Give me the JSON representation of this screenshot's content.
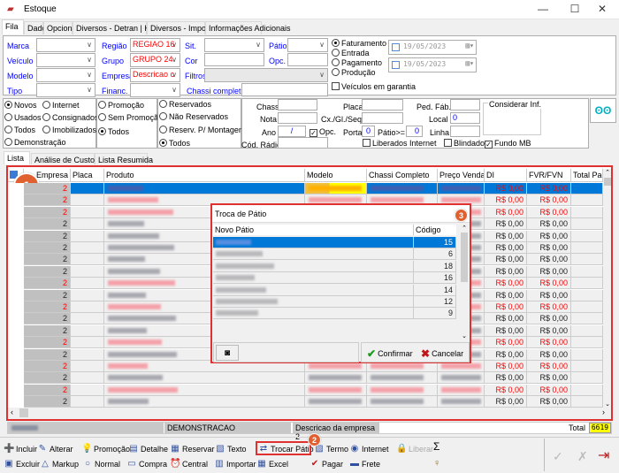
{
  "window": {
    "title": "Estoque",
    "minimize": "—",
    "maximize": "☐",
    "close": "✕"
  },
  "tabs": [
    "Fila",
    "Dados",
    "Opcionais",
    "Diversos - Detran | Hold Back",
    "Diversos - Importados",
    "Informações Adicionais"
  ],
  "filters": {
    "marca": "Marca",
    "veiculo": "Veículo",
    "modelo": "Modelo",
    "tipo": "Tipo",
    "regiao": "Região",
    "regiao_value": "REGIAO 16",
    "grupo": "Grupo",
    "grupo_value": "GRUPO 24",
    "empresa": "Empresa",
    "empresa_value": "Descricao c",
    "financ": "Financ.",
    "sit": "Sit.",
    "cor": "Cor",
    "filtros": "Filtros",
    "chassi_completo": "Chassi completo",
    "patio": "Pátio",
    "opc": "Opc.",
    "date_radios": [
      "Faturamento",
      "Entrada",
      "Pagamento",
      "Produção"
    ],
    "date_selected": "Faturamento",
    "date1": "19/05/2023",
    "date2": "19/05/2023",
    "garantia": "Veículos em garantia"
  },
  "options": {
    "group1": [
      "Novos",
      "Internet",
      "Usados",
      "Consignados",
      "Todos",
      "Imobilizados",
      "Demonstração"
    ],
    "group1_selected": "Novos",
    "group2": [
      "Promoção",
      "Sem Promoção",
      "Todos"
    ],
    "group2_selected": "Todos",
    "group3": [
      "Reservados",
      "Não Reservados",
      "Reserv. P/ Montagem",
      "Todos"
    ],
    "group3_selected": "Todos",
    "chassi": "Chassi",
    "nota": "Nota",
    "ano": "Ano",
    "ano_value": "/",
    "opc": "Opc.",
    "cod_radio": "Cód. Rádio",
    "placa": "Placa",
    "cx": "Cx./Gl./Seq.",
    "porta": "Porta",
    "porta_value": "0",
    "patio_ge": "Pátio>=",
    "patio_value": "0",
    "ped_fab": "Ped. Fáb.",
    "local": "Local",
    "local_value": "0",
    "linha": "Linha",
    "considerar": "Considerar Inf.",
    "liberados": "Liberados Internet",
    "blindado": "Blindado",
    "fundo_mb": "Fundo MB"
  },
  "subtabs": [
    "Lista",
    "Análise de Custos",
    "Lista Resumida"
  ],
  "grid": {
    "columns": [
      "Empresa",
      "Placa",
      "Produto",
      "Modelo",
      "Chassi Completo",
      "Preço Venda",
      "DI",
      "FVR/FVN",
      "Total Pag"
    ],
    "rows": [
      {
        "empresa": "2",
        "di": "R$ 0,00",
        "fvr": "R$ 0,00",
        "highlight": true,
        "selected": true
      },
      {
        "empresa": "2",
        "di": "R$ 0,00",
        "fvr": "R$ 0,00",
        "highlight": true
      },
      {
        "empresa": "2",
        "di": "R$ 0,00",
        "fvr": "R$ 0,00",
        "highlight": true
      },
      {
        "empresa": "2",
        "di": "R$ 0,00",
        "fvr": "R$ 0,00",
        "highlight": false
      },
      {
        "empresa": "2",
        "di": "R$ 0,00",
        "fvr": "R$ 0,00",
        "highlight": false
      },
      {
        "empresa": "2",
        "di": "R$ 0,00",
        "fvr": "R$ 0,00",
        "highlight": false
      },
      {
        "empresa": "2",
        "di": "R$ 0,00",
        "fvr": "R$ 0,00",
        "highlight": false
      },
      {
        "empresa": "2",
        "di": "R$ 0,00",
        "fvr": "R$ 0,00",
        "highlight": false
      },
      {
        "empresa": "2",
        "di": "R$ 0,00",
        "fvr": "R$ 0,00",
        "highlight": true
      },
      {
        "empresa": "2",
        "di": "R$ 0,00",
        "fvr": "R$ 0,00",
        "highlight": false
      },
      {
        "empresa": "2",
        "di": "R$ 0,00",
        "fvr": "R$ 0,00",
        "highlight": true
      },
      {
        "empresa": "2",
        "di": "R$ 0,00",
        "fvr": "R$ 0,00",
        "highlight": false
      },
      {
        "empresa": "2",
        "di": "R$ 0,00",
        "fvr": "R$ 0,00",
        "highlight": false
      },
      {
        "empresa": "2",
        "di": "R$ 0,00",
        "fvr": "R$ 0,00",
        "highlight": true
      },
      {
        "empresa": "2",
        "di": "R$ 0,00",
        "fvr": "R$ 0,00",
        "highlight": false
      },
      {
        "empresa": "2",
        "di": "R$ 0,00",
        "fvr": "R$ 0,00",
        "highlight": true
      },
      {
        "empresa": "2",
        "di": "R$ 0,00",
        "fvr": "R$ 0,00",
        "highlight": false
      },
      {
        "empresa": "2",
        "di": "R$ 0,00",
        "fvr": "R$ 0,00",
        "highlight": true
      },
      {
        "empresa": "2",
        "di": "R$ 0,00",
        "fvr": "R$ 0,00",
        "highlight": false
      }
    ]
  },
  "status": {
    "tipo": "DEMONSTRACAO",
    "empresa": "Descricao da empresa 2",
    "total_label": "Total",
    "total_value": "6619"
  },
  "dialog": {
    "title": "Troca de Pátio",
    "col_patio": "Novo Pátio",
    "col_codigo": "Código",
    "codes": [
      "15",
      "6",
      "18",
      "16",
      "14",
      "12",
      "9"
    ],
    "confirm": "Confirmar",
    "cancel": "Cancelar"
  },
  "badges": [
    "1",
    "2",
    "3"
  ],
  "toolbar": {
    "row1": [
      "Incluir",
      "Alterar",
      "Promoção",
      "Detalhe",
      "Reservar",
      "Texto",
      "Trocar Pátio",
      "Termo",
      "Internet",
      "Liberar",
      "Σ"
    ],
    "row2": [
      "Excluir",
      "Markup",
      "Normal",
      "Compra",
      "Central",
      "Importar",
      "Excel",
      "Pagar",
      "Frete"
    ]
  },
  "colors": {
    "accent": "#0078d7",
    "highlight_red": "#ff0000",
    "annotation": "#e03030",
    "badge": "#e06030",
    "total_bg": "#ffff00"
  }
}
